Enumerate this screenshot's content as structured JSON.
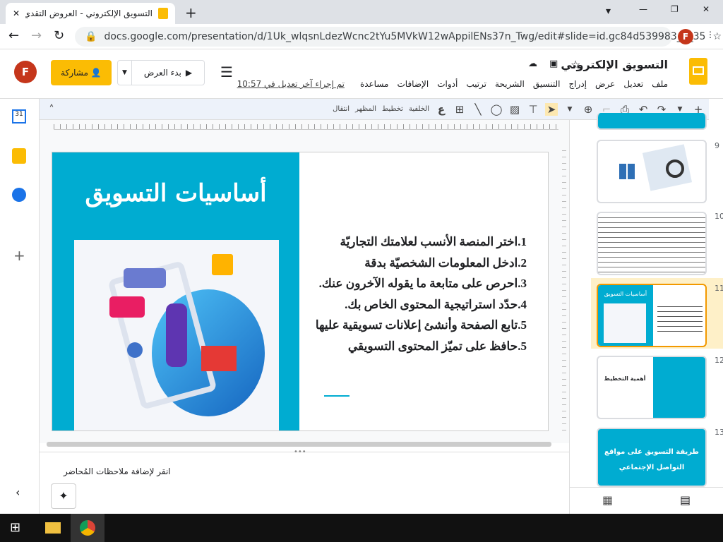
{
  "browser": {
    "tab_title": "التسويق الإلكتروني - العروض التقدي",
    "url": "docs.google.com/presentation/d/1Uk_wlqsnLdezWcnc2tYu5MVkW12wAppilENs37n_Twg/edit#slide=id.gc84d539983_0_35",
    "profile_initial": "F"
  },
  "doc": {
    "title": "التسويق الإلكتروني",
    "share_label": "مشاركة",
    "present_label": "بدء العرض",
    "last_edit": "تم إجراء آخر تعديل في 10:57",
    "user_initial": "F",
    "menus": [
      "ملف",
      "تعديل",
      "عرض",
      "إدراج",
      "التنسيق",
      "الشريحة",
      "ترتيب",
      "أدوات",
      "الإضافات",
      "مساعدة"
    ]
  },
  "toolbar": {
    "background": "الخلفية",
    "layout": "تخطيط",
    "theme": "المظهر",
    "transition": "انتقال"
  },
  "slide": {
    "title": "أساسيات التسويق",
    "items": [
      "1.اختر المنصة الأنسب لعلامتك التجاريّة",
      "2.ادخل المعلومات الشخصيّة بدقة",
      "3.احرص على متابعة ما يقوله الآخرون عنك.",
      "4.حدّد استراتيجية المحتوى الخاص بك.",
      "5.تابع الصفحة وأنشئ إعلانات تسويقية عليها",
      "5.حافظ على تميّز المحتوى التسويقي"
    ]
  },
  "notes": {
    "placeholder": "انقر لإضافة ملاحظات المُحاضر"
  },
  "thumbnails": [
    {
      "num": "9"
    },
    {
      "num": "10"
    },
    {
      "num": "11",
      "selected": true,
      "title": "أساسيات التسويق"
    },
    {
      "num": "12",
      "title": "أهمية التخطيط"
    },
    {
      "num": "13",
      "title": "طريقة التسويق على مواقع التواصل الإجتماعي"
    }
  ],
  "colors": {
    "accent": "#00acd1",
    "share": "#fbbc04",
    "selected": "#fef0c8"
  }
}
